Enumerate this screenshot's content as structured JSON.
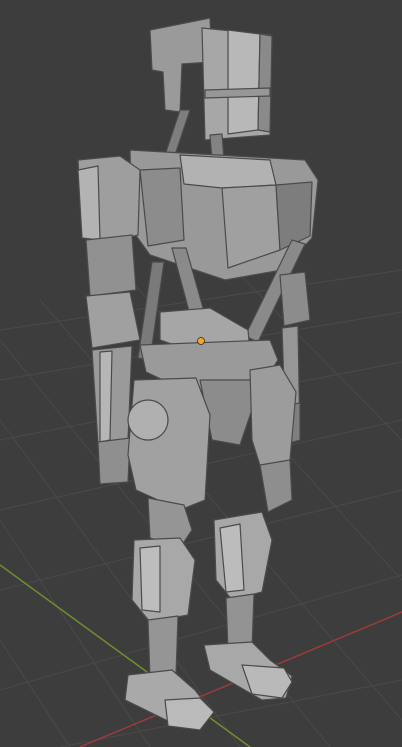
{
  "viewport": {
    "background": "#3d3d3d",
    "grid_color": "#4a4a4a",
    "x_axis_color": "#9c3b3b",
    "y_axis_color": "#6f8f2e",
    "origin_marker_color": "#f5a623",
    "model_fill": "#8e8e8e",
    "model_light": "#b4b4b4",
    "model_dark": "#5e5e5e",
    "model_edge": "#4b4b4b"
  }
}
